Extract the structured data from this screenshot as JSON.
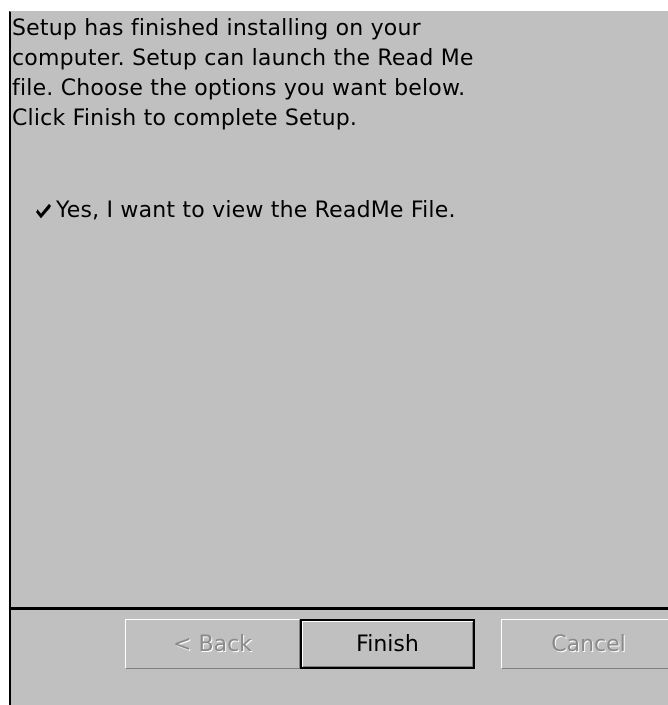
{
  "dialog": {
    "message": "Setup has finished installing on your\ncomputer.  Setup can launch the Read Me\nfile.  Choose the options you want below.\nClick Finish to complete Setup.",
    "option": {
      "label": "Yes, I want to view the ReadMe File.",
      "checked": true
    },
    "buttons": {
      "back_label": "< Back",
      "finish_label": "Finish",
      "cancel_label": "Cancel"
    }
  },
  "colors": {
    "dialog_background": "#c0c0c0",
    "disabled_text": "#8a8a8a"
  }
}
